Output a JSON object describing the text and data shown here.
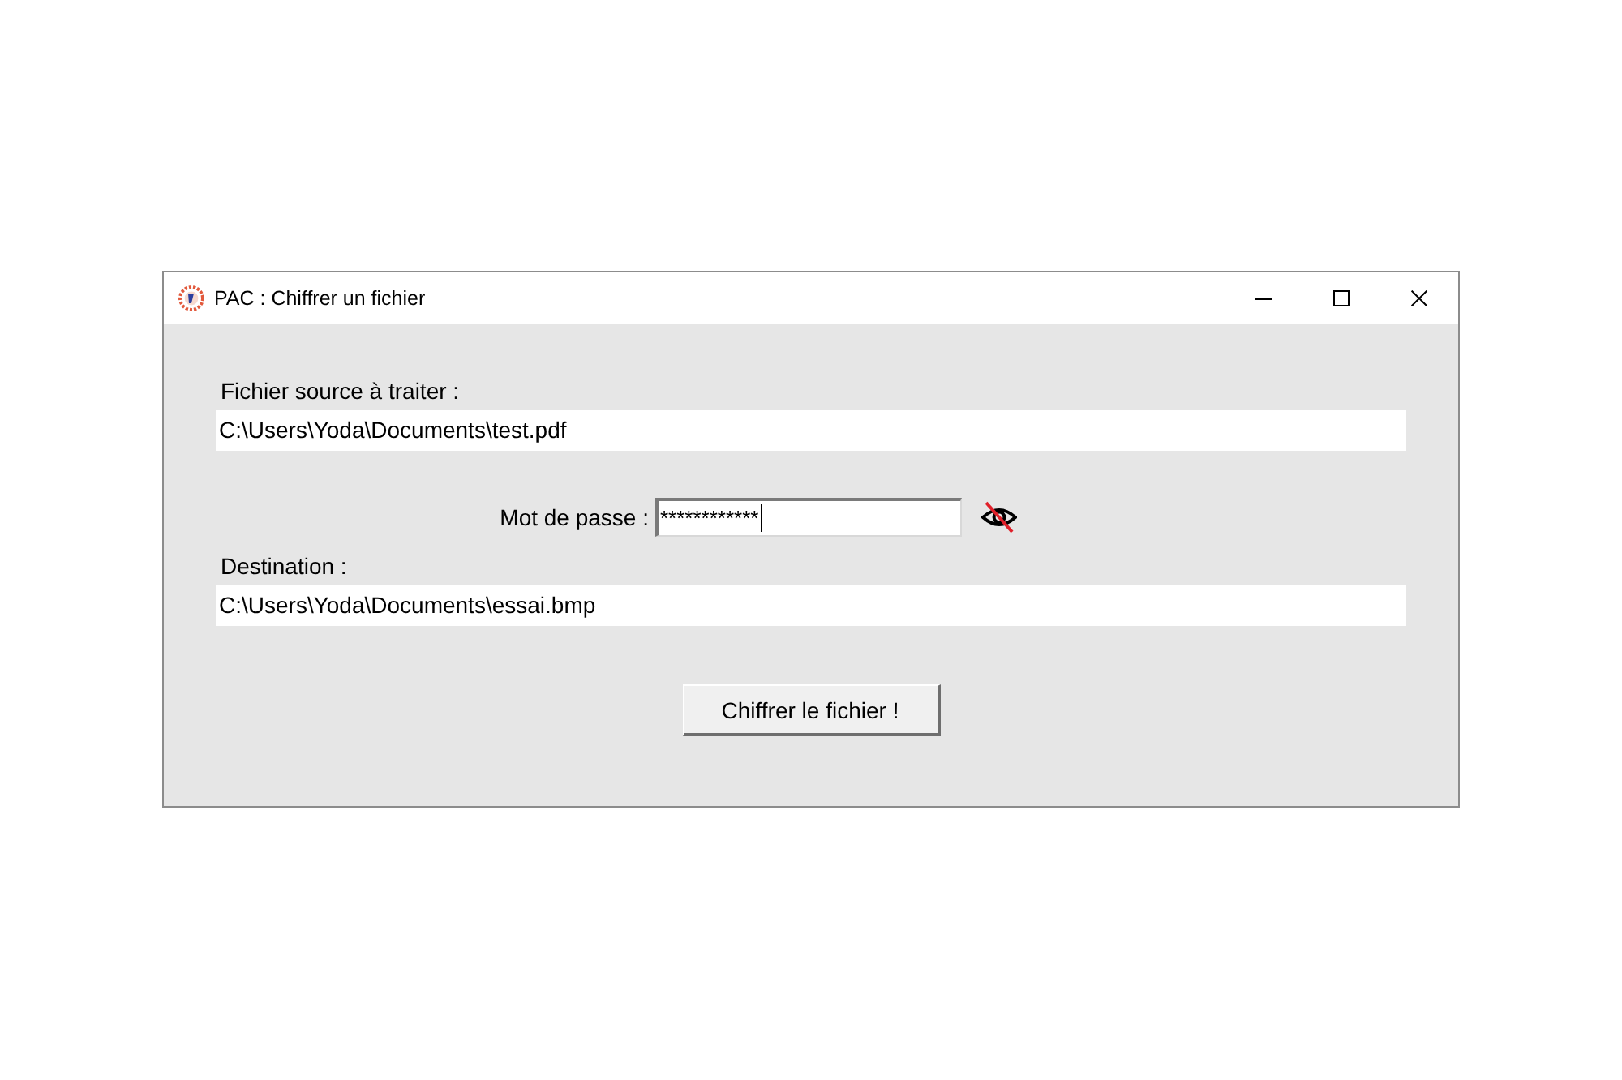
{
  "window": {
    "title": "PAC : Chiffrer un fichier"
  },
  "source": {
    "label": "Fichier source à traiter :",
    "value": "C:\\Users\\Yoda\\Documents\\test.pdf"
  },
  "password": {
    "label": "Mot de passe :",
    "value": "************",
    "focused": true,
    "visible": false
  },
  "destination": {
    "label": "Destination :",
    "value": "C:\\Users\\Yoda\\Documents\\essai.bmp"
  },
  "submit_button": {
    "label": "Chiffrer le fichier !"
  }
}
